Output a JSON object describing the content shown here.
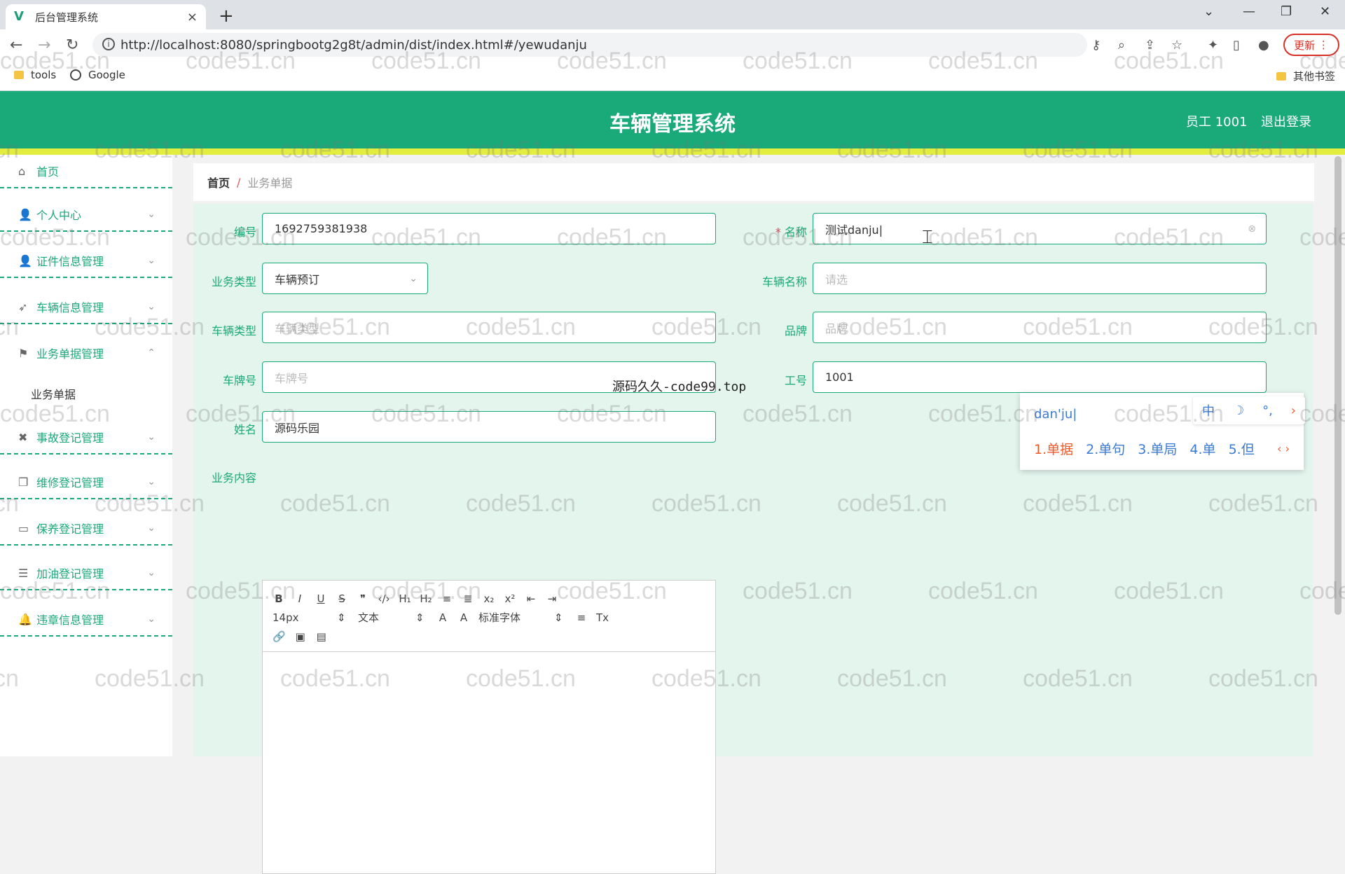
{
  "browser": {
    "tab_title": "后台管理系统",
    "url": "http://localhost:8080/springbootg2g8t/admin/dist/index.html#/yewudanju",
    "update_label": "更新",
    "bookmarks": [
      "tools",
      "Google"
    ],
    "other_bookmarks": "其他书签"
  },
  "app": {
    "title": "车辆管理系统",
    "user": "员工 1001",
    "logout": "退出登录"
  },
  "sidebar": {
    "items": [
      {
        "label": "首页",
        "icon": "home-icon"
      },
      {
        "label": "个人中心",
        "icon": "user-icon"
      },
      {
        "label": "证件信息管理",
        "icon": "user-icon"
      },
      {
        "label": "车辆信息管理",
        "icon": "send-icon"
      },
      {
        "label": "业务单据管理",
        "icon": "flag-icon"
      },
      {
        "label": "事故登记管理",
        "icon": "car-icon"
      },
      {
        "label": "维修登记管理",
        "icon": "copy-icon"
      },
      {
        "label": "保养登记管理",
        "icon": "chat-icon"
      },
      {
        "label": "加油登记管理",
        "icon": "menu-icon"
      },
      {
        "label": "违章信息管理",
        "icon": "bell-icon"
      }
    ],
    "sub_item": "业务单据"
  },
  "breadcrumb": {
    "home": "首页",
    "sep": "/",
    "current": "业务单据"
  },
  "form": {
    "bianhao_label": "编号",
    "bianhao_value": "1692759381938",
    "mingcheng_label": "名称",
    "mingcheng_req": "*",
    "mingcheng_value": "测试danju|",
    "yewuleixing_label": "业务类型",
    "yewuleixing_value": "车辆预订",
    "cheliangmingcheng_label": "车辆名称",
    "cheliangmingcheng_placeholder": "请选",
    "cheliangleixing_label": "车辆类型",
    "cheliangleixing_placeholder": "车辆类型",
    "pinpai_label": "品牌",
    "pinpai_placeholder": "品牌",
    "chepaihao_label": "车牌号",
    "chepaihao_placeholder": "车牌号",
    "gonghao_label": "工号",
    "gonghao_value": "1001",
    "xingming_label": "姓名",
    "xingming_value": "源码乐园",
    "yewuneirong_label": "业务内容"
  },
  "editor": {
    "row1": [
      "B",
      "I",
      "U",
      "S",
      "❞",
      "‹/›",
      "H₁",
      "H₂",
      "≡",
      "≣",
      "x₂",
      "x²",
      "⇤",
      "⇥"
    ],
    "font_size": "14px",
    "text_type": "文本",
    "font_family": "标准字体",
    "row2_icons": [
      "A",
      "A",
      "≡",
      "Tx"
    ],
    "row3_icons": [
      "🔗",
      "▣",
      "▤"
    ]
  },
  "ime": {
    "pinyin": "dan'ju|",
    "candidates": [
      "1.单据",
      "2.单句",
      "3.单局",
      "4.单",
      "5.但"
    ],
    "bar": [
      "中",
      "☽",
      "°,",
      "›"
    ]
  },
  "overlay": "源码久久-code99.top",
  "watermark": "code51.cn"
}
